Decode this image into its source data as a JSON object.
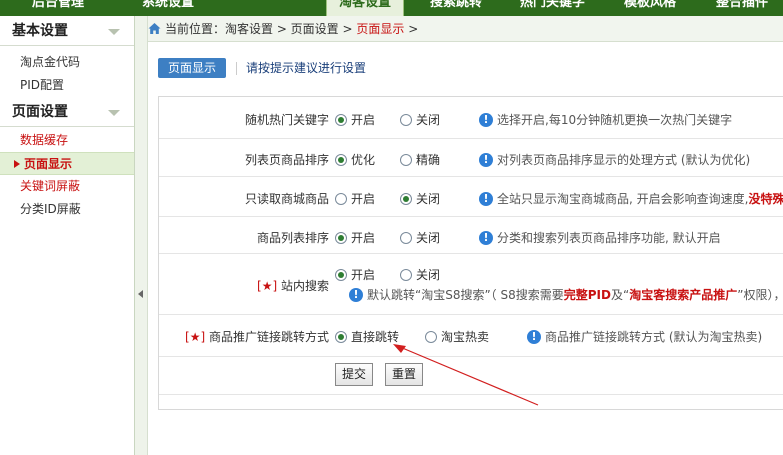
{
  "topnav": {
    "tabs": [
      {
        "label": "后台管理"
      },
      {
        "label": "系统设置"
      },
      {
        "label": "淘客设置"
      },
      {
        "label": "搜索跳转"
      },
      {
        "label": "热门关键字"
      },
      {
        "label": "模板风格"
      },
      {
        "label": "整合插件"
      }
    ]
  },
  "sidebar": {
    "section1": "基本设置",
    "items1": [
      "淘点金代码",
      "PID配置"
    ],
    "section2": "页面设置",
    "items2": [
      "数据缓存",
      "页面显示",
      "关键词屏蔽",
      "分类ID屏蔽"
    ]
  },
  "breadcrumb": {
    "prefix": "当前位置：淘客设置 > 页面设置 > ",
    "current": "页面显示",
    "suffix": " >"
  },
  "subtab": {
    "label": "页面显示",
    "hint": "请按提示建议进行设置"
  },
  "form": {
    "rows": [
      {
        "label": "随机热门关键字",
        "opt1": "开启",
        "opt2": "关闭",
        "selected": 1,
        "tip": "选择开启,每10分钟随机更换一次热门关键字"
      },
      {
        "label": "列表页商品排序",
        "opt1": "优化",
        "opt2": "精确",
        "selected": 1,
        "tip": "对列表页商品排序显示的处理方式 (默认为优化)"
      },
      {
        "label": "只读取商城商品",
        "opt1": "开启",
        "opt2": "关闭",
        "selected": 2,
        "tip_prefix": "全站只显示淘宝商城商品, 开启会影响查询速度,",
        "tip_red": "没特殊"
      },
      {
        "label": "商品列表排序",
        "opt1": "开启",
        "opt2": "关闭",
        "selected": 1,
        "tip": "分类和搜索列表页商品排序功能, 默认开启"
      },
      {
        "star": "[★]",
        "label": " 站内搜索",
        "opt1": "开启",
        "opt2": "关闭",
        "selected": 1,
        "tip_a": "默认跳转“淘宝S8搜索”（ S8搜索需要",
        "tip_b": "完整PID",
        "tip_c": "及“",
        "tip_d": "淘宝客搜索产品推广",
        "tip_e": "”权限），"
      },
      {
        "star": "[★]",
        "label": " 商品推广链接跳转方式",
        "opt1": "直接跳转",
        "opt2": "淘宝热卖",
        "selected": 1,
        "tip": "商品推广链接跳转方式 (默认为淘宝热卖)"
      }
    ],
    "submit_label": "提交",
    "reset_label": "重置"
  },
  "colors": {
    "nav_green": "#2d6b1c",
    "accent_blue": "#3d7fc3",
    "highlight_red": "#c81212",
    "info_blue": "#2f7fd6"
  }
}
